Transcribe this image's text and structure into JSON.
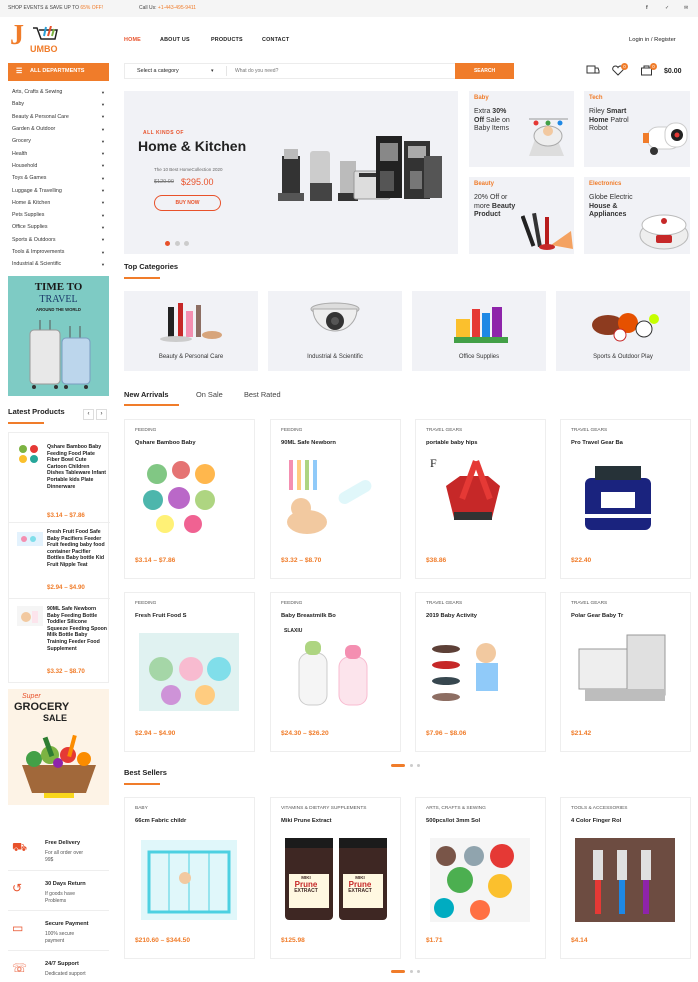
{
  "topbar": {
    "promo_prefix": "SHOP EVENTS & SAVE UP TO",
    "promo_value": "65% OFF!",
    "call_prefix": "Call Us:",
    "call_number": "+1-443-495-9411"
  },
  "logo": {
    "text": "UMBO",
    "letter": "J"
  },
  "nav": {
    "home": "HOME",
    "about": "ABOUT US",
    "products": "PRODUCTS",
    "contact": "CONTACT"
  },
  "account": "Login in / Register",
  "departments": "ALL DEPARTMENTS",
  "search": {
    "category": "Select a category",
    "placeholder": "What do you need?",
    "button": "SEARCH"
  },
  "cart": {
    "wishlist_count": "0",
    "cart_count": "0",
    "total": "$0.00"
  },
  "categories": [
    "Arts, Crafts & Sewing",
    "Baby",
    "Beauty & Personal Care",
    "Garden & Outdoor",
    "Grocery",
    "Health",
    "Household",
    "Toys & Games",
    "Luggage & Travelling",
    "Home & Kitchen",
    "Pets Supplies",
    "Office Supplies",
    "Sports & Outdoors",
    "Tools & Improvements",
    "Industrial & Scientific"
  ],
  "travel_banner": {
    "line1": "TIME TO",
    "line2": "TRAVEL",
    "line3": "AROUND THE WORLD"
  },
  "hero": {
    "kicker": "ALL KINDS OF",
    "title": "Home & Kitchen",
    "sub": "The 10 Best HomeCollection 2020",
    "old_price": "$120.00",
    "price": "$295.00",
    "button": "BUY NOW"
  },
  "promos": [
    {
      "label": "Baby",
      "l1": "Extra ",
      "b1": "30%",
      "l2": "Off",
      "l2b": " Sale on",
      "l3": "Baby Items"
    },
    {
      "label": "Tech",
      "l1": "Riley ",
      "b1": "Smart",
      "l2": "Home",
      "l2b": " Patrol",
      "l3": "Robot"
    },
    {
      "label": "Beauty",
      "l1": "20% Off or",
      "b1": "",
      "l2": "more ",
      "l2b": "Beauty",
      "l3": "Product"
    },
    {
      "label": "Electronics",
      "l1": "Globe Electric",
      "b1": "",
      "l2": "House &",
      "l2b": "",
      "l3": "Appliances"
    }
  ],
  "top_categories": {
    "title": "Top Categories",
    "items": [
      "Beauty & Personal Care",
      "Industrial & Scientific",
      "Office Supplies",
      "Sports & Outdoor Play"
    ]
  },
  "tabs": [
    "New Arrivals",
    "On Sale",
    "Best Rated"
  ],
  "latest": {
    "title": "Latest Products",
    "items": [
      {
        "name": "Qshare Bamboo Baby Feeding Food Plate Fiber Bowl Cute Cartoon Children Dishes Tableware Infant Portable kids Plate Dinnerware",
        "price": "$3.14 – $7.86"
      },
      {
        "name": "Fresh Fruit Food Safe Baby Pacifiers Feeder Fruit feeding baby food container Pacifier Bottles Baby bottle Kid Fruit Nipple Teat",
        "price": "$2.94 – $4.90"
      },
      {
        "name": "90ML Safe Newborn Baby Feeding Bottle Toddler Silicone Squeeze Feeding Spoon Milk Bottle Baby Training Feeder Food Supplement",
        "price": "$3.32 – $8.70"
      }
    ]
  },
  "grocery_banner": {
    "l1": "Super",
    "l2": "GROCERY",
    "l3": "SALE"
  },
  "arrivals": [
    {
      "cat": "FEEDING",
      "name": "Qshare Bamboo Baby",
      "price": "$3.14 – $7.86"
    },
    {
      "cat": "FEEDING",
      "name": "90ML Safe Newborn",
      "price": "$3.32 – $8.70"
    },
    {
      "cat": "TRAVEL GEARS",
      "name": "portable baby hips",
      "price": "$38.86"
    },
    {
      "cat": "TRAVEL GEARS",
      "name": "Pro Travel Gear Ba",
      "price": "$22.40"
    },
    {
      "cat": "FEEDING",
      "name": "Fresh Fruit Food S",
      "price": "$2.94 – $4.90"
    },
    {
      "cat": "FEEDING",
      "name": "Baby Breastmilk Bo",
      "price": "$24.30 – $26.20"
    },
    {
      "cat": "TRAVEL GEARS",
      "name": "2019 Baby Activity",
      "price": "$7.96 – $8.06"
    },
    {
      "cat": "TRAVEL GEARS",
      "name": "Polar Gear Baby Tr",
      "price": "$21.42"
    }
  ],
  "best_sellers": {
    "title": "Best Sellers",
    "items": [
      {
        "cat": "BABY",
        "name": "66cm Fabric childr",
        "price": "$210.60 – $344.50"
      },
      {
        "cat": "VITAMINS & DIETARY SUPPLEMENTS",
        "name": "Miki Prune Extract",
        "price": "$125.98"
      },
      {
        "cat": "ARTS, CRAFTS & SEWING",
        "name": "500pcs/lot 3mm Sol",
        "price": "$1.71"
      },
      {
        "cat": "TOOLS & ACCESSORIES",
        "name": "4 Color Finger Rol",
        "price": "$4.14"
      }
    ]
  },
  "product_labels": {
    "prune_brand": "MIKI",
    "prune_line1": "Prune",
    "prune_line2": "EXTRACT",
    "f_letter": "F",
    "slaxiu": "SLAXIU"
  },
  "features": [
    {
      "title": "Free Delivery",
      "sub1": "For all order over",
      "sub2": "99$"
    },
    {
      "title": "30 Days Return",
      "sub1": "If goods have",
      "sub2": "Problems"
    },
    {
      "title": "Secure Payment",
      "sub1": "100% secure",
      "sub2": "payment"
    },
    {
      "title": "24/7 Support",
      "sub1": "Dedicated support",
      "sub2": ""
    }
  ],
  "colors": {
    "accent": "#f07c2a",
    "bg_panel": "#f1f2f6"
  }
}
